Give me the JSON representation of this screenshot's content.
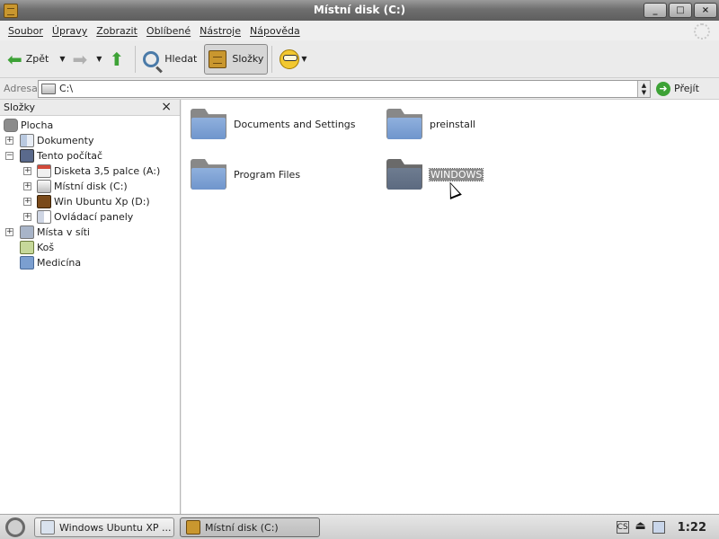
{
  "window": {
    "title": "Místní disk (C:)",
    "buttons": [
      "_",
      "□",
      "×"
    ]
  },
  "menubar": [
    "Soubor",
    "Úpravy",
    "Zobrazit",
    "Oblíbené",
    "Nástroje",
    "Nápověda"
  ],
  "toolbar": {
    "back_label": "Zpět",
    "search_label": "Hledat",
    "folders_label": "Složky"
  },
  "address": {
    "label": "Adresa",
    "value": "C:\\",
    "go_label": "Přejít"
  },
  "folder_pane": {
    "title": "Složky",
    "close": "×",
    "tree": [
      {
        "label": "Plocha",
        "icon": "desktop-icon",
        "expander": ""
      },
      {
        "label": "Dokumenty",
        "icon": "documents-icon",
        "expander": "+"
      },
      {
        "label": "Tento počítač",
        "icon": "computer-icon",
        "expander": "−"
      },
      {
        "label": "Disketa 3,5 palce (A:)",
        "icon": "floppy-icon",
        "expander": "+"
      },
      {
        "label": "Místní disk (C:)",
        "icon": "hard-drive-icon",
        "expander": "+"
      },
      {
        "label": "Win Ubuntu Xp (D:)",
        "icon": "cd-drive-icon",
        "expander": "+"
      },
      {
        "label": "Ovládací panely",
        "icon": "control-panel-icon",
        "expander": "+"
      },
      {
        "label": "Místa v síti",
        "icon": "network-icon",
        "expander": "+"
      },
      {
        "label": "Koš",
        "icon": "trash-icon",
        "expander": ""
      },
      {
        "label": "Medicína",
        "icon": "folder-icon",
        "expander": ""
      }
    ]
  },
  "content": {
    "items": [
      {
        "label": "Documents and Settings"
      },
      {
        "label": "preinstall"
      },
      {
        "label": "Program Files"
      },
      {
        "label": "WINDOWS",
        "selected": true
      }
    ]
  },
  "taskbar": {
    "tasks": [
      {
        "label": "Windows Ubuntu XP ..."
      },
      {
        "label": "Místní disk (C:)",
        "active": true
      }
    ],
    "clock": "1:22",
    "tray": {
      "keyboard": "CS"
    }
  }
}
